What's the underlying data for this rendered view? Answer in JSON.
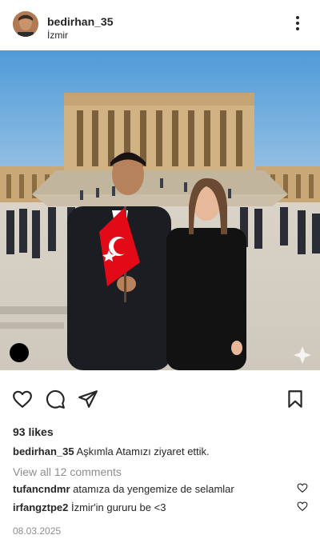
{
  "post": {
    "username": "bedirhan_35",
    "location": "İzmir",
    "likes": "93 likes",
    "caption_user": "bedirhan_35",
    "caption_text": "Aşkımla Atamızı ziyaret ettik.",
    "view_all": "View all 12 comments",
    "date": "08.03.2025"
  },
  "comments": [
    {
      "user": "tufancndmr",
      "text": "atamıza da yengemize de selamlar"
    },
    {
      "user": "irfangztpe2",
      "text": "İzmir'in gururu be <3"
    }
  ],
  "icons": {
    "more": "more-vertical-icon",
    "like": "heart-icon",
    "comment": "comment-bubble-icon",
    "share": "paper-plane-icon",
    "save": "bookmark-icon"
  },
  "colors": {
    "text": "#262626",
    "secondary": "#8e8e8e",
    "flag_red": "#e30a17"
  }
}
